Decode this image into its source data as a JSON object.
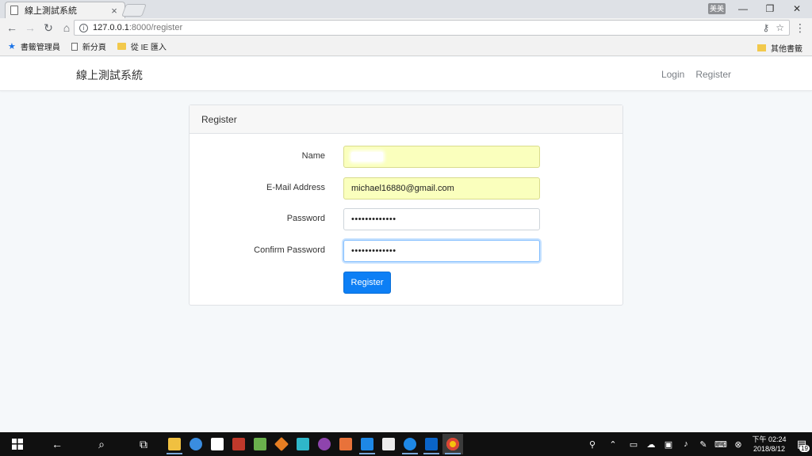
{
  "browser": {
    "tab_title": "線上測試系統",
    "tab_close": "×",
    "window_controls": {
      "user": "美美",
      "minimize": "—",
      "restore": "❐",
      "close": "✕"
    },
    "url_host": "127.0.0.1",
    "url_rest": ":8000/register",
    "bookmarks": [
      {
        "label": "書籤管理員",
        "icon": "star-icon"
      },
      {
        "label": "新分頁",
        "icon": "page-icon"
      },
      {
        "label": "從 IE 匯入",
        "icon": "folder-icon"
      }
    ],
    "other_bookmarks": "其他書籤"
  },
  "app": {
    "brand": "線上測試系統",
    "nav": {
      "login": "Login",
      "register": "Register"
    }
  },
  "form": {
    "header": "Register",
    "name_label": "Name",
    "email_label": "E-Mail Address",
    "email_value": "michael16880@gmail.com",
    "password_label": "Password",
    "password_value": "•••••••••••••",
    "confirm_label": "Confirm Password",
    "confirm_value": "•••••••••••••",
    "submit_label": "Register"
  },
  "taskbar": {
    "clock_time": "下午 02:24",
    "clock_date": "2018/8/12",
    "notification_count": "19",
    "app_colors": [
      "#f0c040",
      "#3a8de0",
      "#ffffff",
      "#c0392b",
      "#6ab04c",
      "#e67e22",
      "#2fb7c9",
      "#8e44ad",
      "#e8723a",
      "#1e88e5",
      "#ececec",
      "#1e88e5",
      "#0a64c8",
      "#f4c20d"
    ]
  }
}
